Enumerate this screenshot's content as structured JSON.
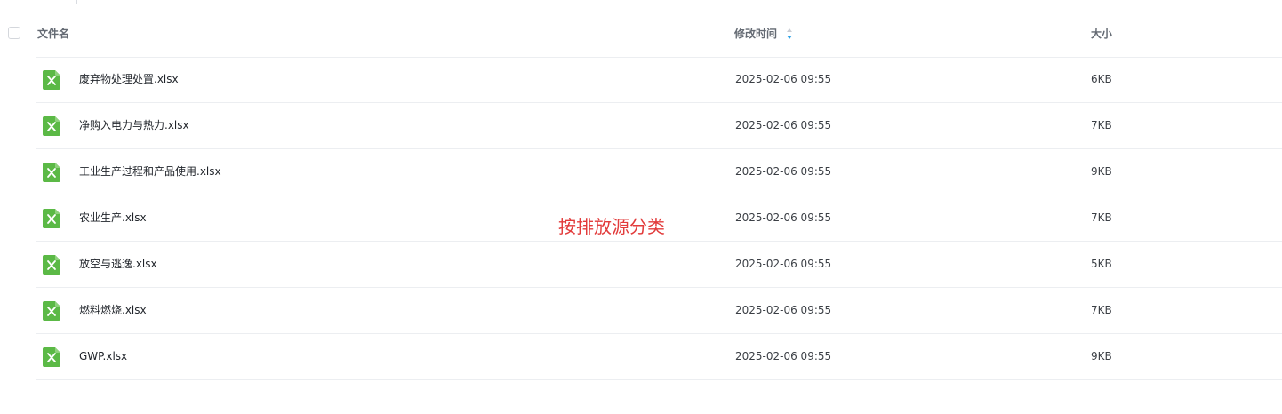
{
  "table": {
    "headers": {
      "name": "文件名",
      "modified": "修改时间",
      "size": "大小"
    },
    "sort_icon": "sort-up-down-icon",
    "file_icon": "excel-file-icon",
    "rows": [
      {
        "name": "废弃物处理处置.xlsx",
        "modified": "2025-02-06 09:55",
        "size": "6KB"
      },
      {
        "name": "净购入电力与热力.xlsx",
        "modified": "2025-02-06 09:55",
        "size": "7KB"
      },
      {
        "name": "工业生产过程和产品使用.xlsx",
        "modified": "2025-02-06 09:55",
        "size": "9KB"
      },
      {
        "name": "农业生产.xlsx",
        "modified": "2025-02-06 09:55",
        "size": "7KB"
      },
      {
        "name": "放空与逃逸.xlsx",
        "modified": "2025-02-06 09:55",
        "size": "5KB"
      },
      {
        "name": "燃料燃烧.xlsx",
        "modified": "2025-02-06 09:55",
        "size": "7KB"
      },
      {
        "name": "GWP.xlsx",
        "modified": "2025-02-06 09:55",
        "size": "9KB"
      }
    ]
  },
  "annotation": {
    "text": "按排放源分类",
    "color": "#e23b3b"
  },
  "colors": {
    "excel_green": "#5bb946",
    "sort_active": "#2aa1e6",
    "header_text": "#646a73",
    "divider": "#eceef1"
  }
}
